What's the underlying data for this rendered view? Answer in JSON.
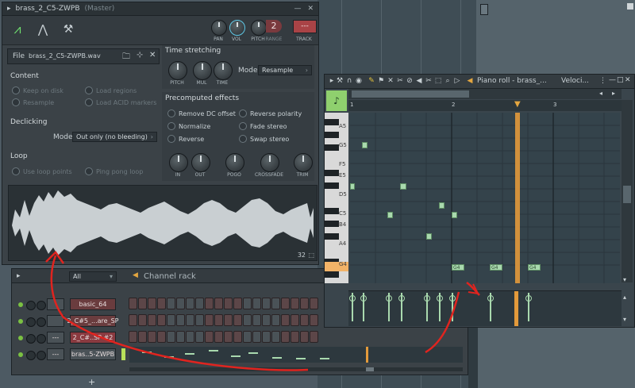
{
  "sampler": {
    "title": "brass_2_C5-ZWPB",
    "title_suffix": "(Master)",
    "toolbar": {
      "pan_label": "PAN",
      "vol_label": "VOL",
      "pitch_label": "PITCH",
      "range_label": "RANGE",
      "range_value": "2",
      "track_label": "TRACK",
      "track_value": "---"
    },
    "file_label": "File",
    "file_name": "brass_2_C5-ZWPB.wav",
    "content": {
      "title": "Content",
      "keep_on_disk": "Keep on disk",
      "load_regions": "Load regions",
      "resample": "Resample",
      "load_acid": "Load ACID markers"
    },
    "declicking": {
      "title": "Declicking",
      "mode_label": "Mode",
      "mode_value": "Out only (no bleeding)"
    },
    "loop": {
      "title": "Loop",
      "use_loop_points": "Use loop points",
      "ping_pong": "Ping pong loop"
    },
    "time_stretching": {
      "title": "Time stretching",
      "pitch": "PITCH",
      "mul": "MUL",
      "time": "TIME",
      "mode_label": "Mode",
      "mode_value": "Resample"
    },
    "precomputed": {
      "title": "Precomputed effects",
      "remove_dc": "Remove DC offset",
      "reverse_polarity": "Reverse polarity",
      "normalize": "Normalize",
      "fade_stereo": "Fade stereo",
      "reverse": "Reverse",
      "swap_stereo": "Swap stereo",
      "in": "IN",
      "out": "OUT",
      "pogo": "POGO",
      "crossfade": "CROSSFADE",
      "trim": "TRIM"
    },
    "waveform_zoom": "32"
  },
  "channel_rack": {
    "filter_value": "All",
    "title": "Channel rack",
    "channels": [
      {
        "name": "basic_64"
      },
      {
        "name": "2_C#5_...are_SP"
      },
      {
        "name": "2_C#..SP #2"
      },
      {
        "name": "bras..5-ZWPB"
      }
    ],
    "row_dash": "---",
    "add_label": "+"
  },
  "piano_roll": {
    "title": "Piano roll - brass_...",
    "velocity_label": "Veloci...",
    "bar_numbers": [
      "1",
      "2",
      "3"
    ],
    "key_labels": [
      "A5",
      "G5",
      "F5",
      "E5",
      "D5",
      "C5",
      "B4",
      "A4",
      "G4"
    ],
    "note_label": "G4"
  },
  "colors": {
    "accent_green": "#a9d9ae",
    "playhead": "#e39a3b",
    "channel_red": "#6a3c3e",
    "annotation_arrow": "#e0241f"
  }
}
